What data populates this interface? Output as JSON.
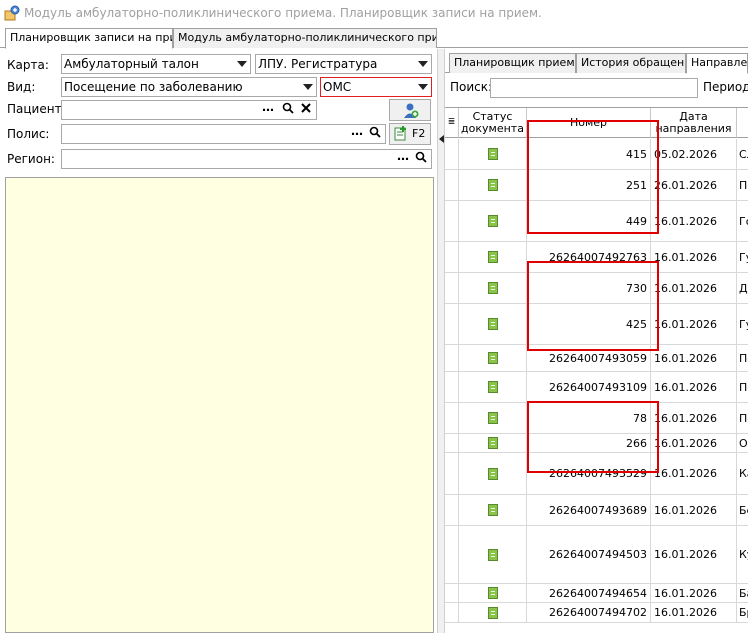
{
  "window": {
    "title": "Модуль амбулаторно-поликлинического приема. Планировщик записи на прием."
  },
  "main_tabs": [
    {
      "label": "Планировщик записи на прием",
      "active": true
    },
    {
      "label": "Модуль амбулаторно-поликлинического приема",
      "active": false
    }
  ],
  "form": {
    "karta_label": "Карта:",
    "karta_value": "Амбулаторный талон",
    "lpu_value": "ЛПУ. Регистратура",
    "vid_label": "Вид:",
    "vid_value": "Посещение по заболеванию",
    "oms_value": "ОМС",
    "patient_label": "Пациент:",
    "polis_label": "Полис:",
    "f2_label": "F2",
    "region_label": "Регион:"
  },
  "sub_tabs": [
    {
      "label": "Планировщик приемов"
    },
    {
      "label": "История обращения"
    },
    {
      "label": "Направлени"
    }
  ],
  "search": {
    "label": "Поиск:",
    "value": "",
    "period_label": "Период"
  },
  "grid": {
    "headers": {
      "status": "Статус документа",
      "number": "Номер",
      "date": "Дата направления"
    },
    "rows": [
      {
        "number": "415",
        "date": "05.02.2026",
        "extra": "Сл"
      },
      {
        "number": "251",
        "date": "26.01.2026",
        "extra": "Пе"
      },
      {
        "number": "449",
        "date": "16.01.2026",
        "extra": "Го"
      },
      {
        "number": "26264007492763",
        "date": "16.01.2026",
        "extra": "Гу"
      },
      {
        "number": "730",
        "date": "16.01.2026",
        "extra": "Де"
      },
      {
        "number": "425",
        "date": "16.01.2026",
        "extra": "Гу"
      },
      {
        "number": "26264007493059",
        "date": "16.01.2026",
        "extra": "По"
      },
      {
        "number": "26264007493109",
        "date": "16.01.2026",
        "extra": "По"
      },
      {
        "number": "78",
        "date": "16.01.2026",
        "extra": "По"
      },
      {
        "number": "266",
        "date": "16.01.2026",
        "extra": "Ог"
      },
      {
        "number": "26264007493529",
        "date": "16.01.2026",
        "extra": "Ка"
      },
      {
        "number": "26264007493689",
        "date": "16.01.2026",
        "extra": "Бе"
      },
      {
        "number": "26264007494503",
        "date": "16.01.2026",
        "extra": "Ку"
      },
      {
        "number": "26264007494654",
        "date": "16.01.2026",
        "extra": "Ба"
      },
      {
        "number": "26264007494702",
        "date": "16.01.2026",
        "extra": "Бр"
      }
    ]
  },
  "colors": {
    "highlight": "#e00000",
    "yellow_area": "#ffffe1"
  }
}
